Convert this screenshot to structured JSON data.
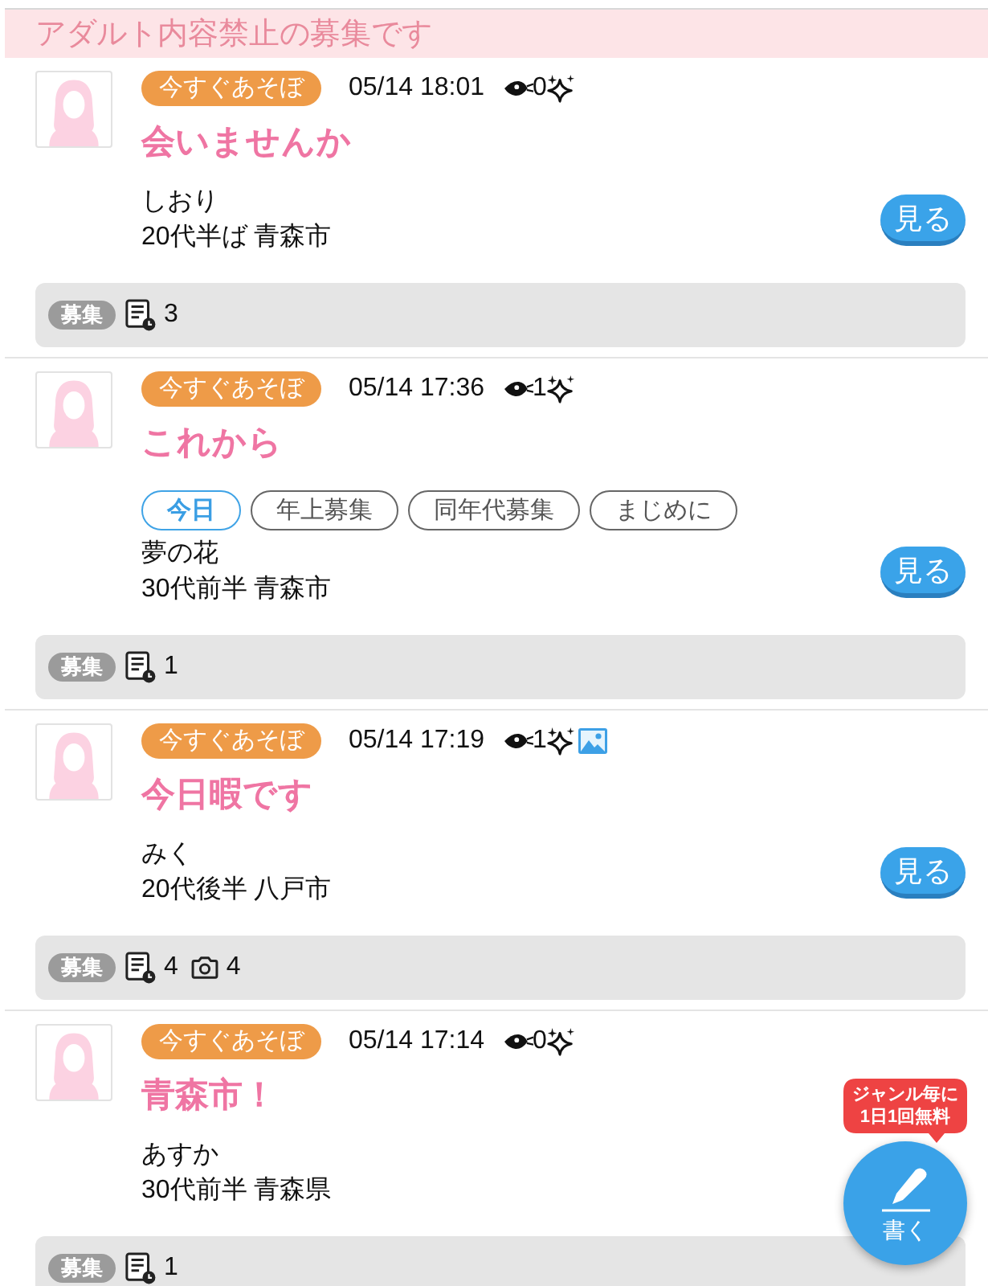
{
  "notice": "アダルト内容禁止の募集です",
  "posts": [
    {
      "category": "今すぐあそぼ",
      "date": "05/14 18:01",
      "views": "0",
      "has_image": false,
      "title": "会いませんか",
      "name": "しおり",
      "profile": "20代半ば 青森市",
      "view_button": "見る",
      "footer": {
        "label": "募集",
        "stats": [
          {
            "kind": "replies",
            "count": "3"
          }
        ]
      }
    },
    {
      "category": "今すぐあそぼ",
      "date": "05/14 17:36",
      "views": "1",
      "has_image": false,
      "title": "これから",
      "tags": [
        {
          "label": "今日",
          "highlighted": true
        },
        {
          "label": "年上募集",
          "highlighted": false
        },
        {
          "label": "同年代募集",
          "highlighted": false
        },
        {
          "label": "まじめに",
          "highlighted": false
        }
      ],
      "name": "夢の花",
      "profile": "30代前半 青森市",
      "view_button": "見る",
      "footer": {
        "label": "募集",
        "stats": [
          {
            "kind": "replies",
            "count": "1"
          }
        ]
      }
    },
    {
      "category": "今すぐあそぼ",
      "date": "05/14 17:19",
      "views": "1",
      "has_image": true,
      "title": "今日暇です",
      "name": "みく",
      "profile": "20代後半 八戸市",
      "view_button": "見る",
      "footer": {
        "label": "募集",
        "stats": [
          {
            "kind": "replies",
            "count": "4"
          },
          {
            "kind": "photos",
            "count": "4"
          }
        ]
      }
    },
    {
      "category": "今すぐあそぼ",
      "date": "05/14 17:14",
      "views": "0",
      "has_image": false,
      "title": "青森市！",
      "name": "あすか",
      "profile": "30代前半 青森県",
      "footer": {
        "label": "募集",
        "stats": [
          {
            "kind": "replies",
            "count": "1"
          }
        ]
      }
    }
  ],
  "write_button": {
    "label": "書く",
    "tooltip": [
      "ジャンル毎に",
      "1日1回無料"
    ]
  }
}
